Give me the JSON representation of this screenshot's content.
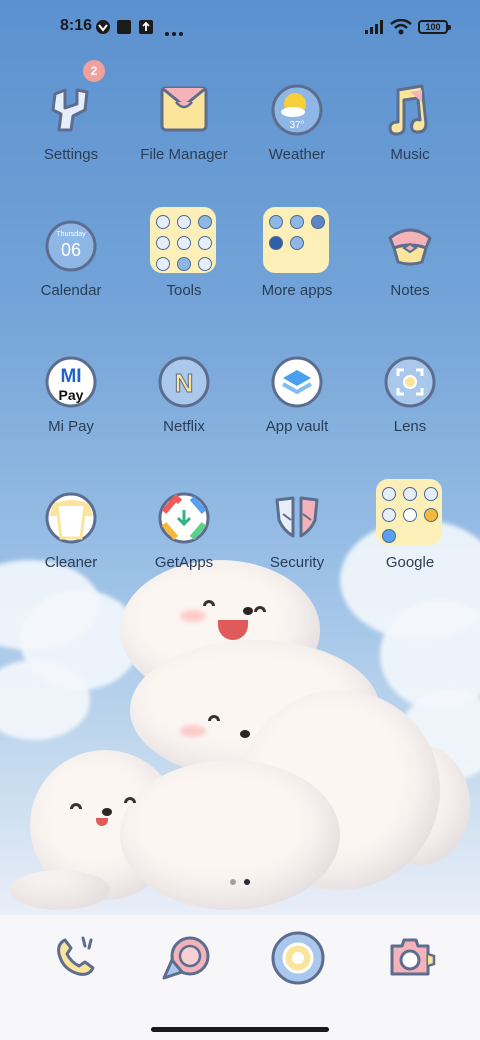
{
  "status_bar": {
    "time": "8:16",
    "battery": "100",
    "icons": [
      "vpn-icon",
      "notification-square-icon",
      "upload-icon",
      "more-dots-icon",
      "signal-icon",
      "wifi-icon",
      "battery-icon"
    ]
  },
  "apps": [
    {
      "label": "Settings",
      "icon": "settings-icon",
      "badge": "2"
    },
    {
      "label": "File Manager",
      "icon": "file-manager-icon"
    },
    {
      "label": "Weather",
      "icon": "weather-icon",
      "temperature": "37°"
    },
    {
      "label": "Music",
      "icon": "music-icon"
    },
    {
      "label": "Calendar",
      "icon": "calendar-icon",
      "day_name": "Thursday",
      "date": "06"
    },
    {
      "label": "Tools",
      "icon": "folder-icon"
    },
    {
      "label": "More apps",
      "icon": "folder-icon"
    },
    {
      "label": "Notes",
      "icon": "notes-icon"
    },
    {
      "label": "Mi Pay",
      "icon": "mi-pay-icon",
      "icon_text_1": "MI",
      "icon_text_2": "Pay"
    },
    {
      "label": "Netflix",
      "icon": "netflix-icon",
      "icon_text": "N"
    },
    {
      "label": "App vault",
      "icon": "app-vault-icon"
    },
    {
      "label": "Lens",
      "icon": "lens-icon"
    },
    {
      "label": "Cleaner",
      "icon": "cleaner-icon"
    },
    {
      "label": "GetApps",
      "icon": "getapps-icon"
    },
    {
      "label": "Security",
      "icon": "security-icon"
    },
    {
      "label": "Google",
      "icon": "folder-icon"
    }
  ],
  "page_indicator": {
    "pages": 2,
    "current": 2
  },
  "dock": [
    {
      "icon": "phone-icon"
    },
    {
      "icon": "messages-icon"
    },
    {
      "icon": "browser-icon"
    },
    {
      "icon": "camera-icon"
    }
  ],
  "colors": {
    "icon_stroke": "#5d6d8f",
    "label_text": "#2b3d55",
    "folder_bg": "#fcefb8",
    "badge": "#f2a09c",
    "pink_accent": "#f4b3b8",
    "yellow_accent": "#fbe59a"
  }
}
